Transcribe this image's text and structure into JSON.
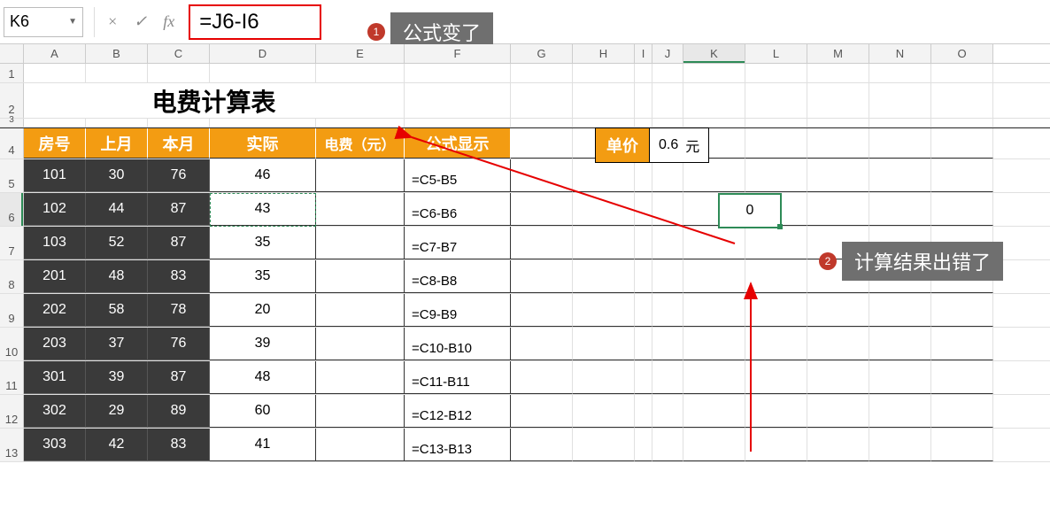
{
  "formula_bar": {
    "name_box": "K6",
    "cancel_icon": "×",
    "confirm_icon": "✓",
    "fx_icon": "fx",
    "formula": "=J6-I6"
  },
  "callouts": {
    "c1_num": "1",
    "c1_text": "公式变了",
    "c2_num": "2",
    "c2_text": "计算结果出错了"
  },
  "columns": [
    "A",
    "B",
    "C",
    "D",
    "E",
    "F",
    "G",
    "H",
    "I",
    "J",
    "K",
    "L",
    "M",
    "N",
    "O"
  ],
  "row_numbers": [
    "1",
    "2",
    "3",
    "4",
    "5",
    "6",
    "7",
    "8",
    "9",
    "10",
    "11",
    "12",
    "13"
  ],
  "title": "电费计算表",
  "headers": {
    "room": "房号",
    "last_month": "上月",
    "this_month": "本月",
    "actual": "实际",
    "fee": "电费（元）",
    "formula_display": "公式显示"
  },
  "price": {
    "label": "单价",
    "value": "0.6",
    "unit": "元"
  },
  "active_cell_value": "0",
  "rows": [
    {
      "room": "101",
      "last": "30",
      "this": "76",
      "actual": "46",
      "formula": "=C5-B5"
    },
    {
      "room": "102",
      "last": "44",
      "this": "87",
      "actual": "43",
      "formula": "=C6-B6"
    },
    {
      "room": "103",
      "last": "52",
      "this": "87",
      "actual": "35",
      "formula": "=C7-B7"
    },
    {
      "room": "201",
      "last": "48",
      "this": "83",
      "actual": "35",
      "formula": "=C8-B8"
    },
    {
      "room": "202",
      "last": "58",
      "this": "78",
      "actual": "20",
      "formula": "=C9-B9"
    },
    {
      "room": "203",
      "last": "37",
      "this": "76",
      "actual": "39",
      "formula": "=C10-B10"
    },
    {
      "room": "301",
      "last": "39",
      "this": "87",
      "actual": "48",
      "formula": "=C11-B11"
    },
    {
      "room": "302",
      "last": "29",
      "this": "89",
      "actual": "60",
      "formula": "=C12-B12"
    },
    {
      "room": "303",
      "last": "42",
      "this": "83",
      "actual": "41",
      "formula": "=C13-B13"
    }
  ]
}
